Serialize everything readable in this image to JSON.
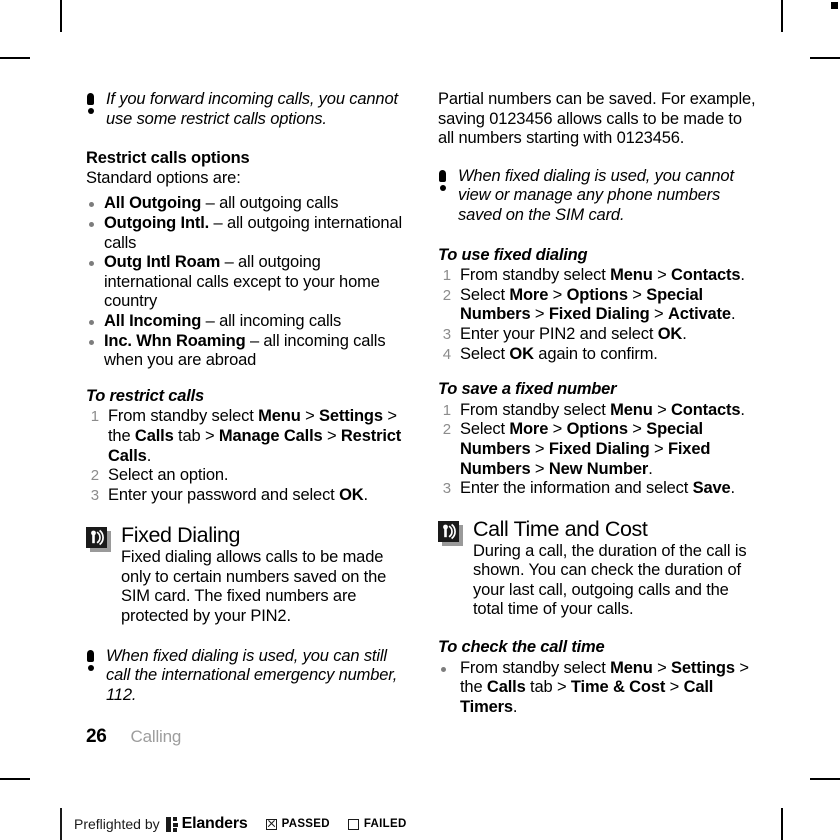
{
  "document": {
    "folio": "26",
    "chapter": "Calling"
  },
  "left_column": {
    "note_forward": {
      "icon": "exclamation-note-icon",
      "text": "If you forward incoming calls, you cannot use some restrict calls options."
    },
    "restrict_options": {
      "heading": "Restrict calls options",
      "intro": "Standard options are:",
      "items": [
        {
          "term": "All Outgoing",
          "desc": " – all outgoing calls"
        },
        {
          "term": "Outgoing Intl.",
          "desc": " – all outgoing international calls"
        },
        {
          "term": "Outg Intl Roam",
          "desc": " – all outgoing international calls except to your home country"
        },
        {
          "term": "All Incoming",
          "desc": " – all incoming calls"
        },
        {
          "term": "Inc. Whn Roaming",
          "desc": " – all incoming calls when you are abroad"
        }
      ]
    },
    "to_restrict_calls": {
      "heading": "To restrict calls",
      "steps": [
        {
          "num": "1",
          "html": "From standby select <b>Menu</b> > <b>Settings</b> > the <b>Calls</b> tab > <b>Manage Calls</b> > <b>Restrict Calls</b>."
        },
        {
          "num": "2",
          "html": "Select an option."
        },
        {
          "num": "3",
          "html": "Enter your password and select <b>OK</b>."
        }
      ]
    },
    "fixed_dialing": {
      "icon": "signal-section-icon",
      "title": "Fixed Dialing",
      "body": "Fixed dialing allows calls to be made only to certain numbers saved on the SIM card. The fixed numbers are protected by your PIN2."
    },
    "note_emergency": {
      "icon": "exclamation-note-icon",
      "text": "When fixed dialing is used, you can still call the international emergency number, 112."
    }
  },
  "right_column": {
    "partial_numbers": "Partial numbers can be saved. For example, saving 0123456 allows calls to be made to all numbers starting with 0123456.",
    "note_sim": {
      "icon": "exclamation-note-icon",
      "text": "When fixed dialing is used, you cannot view or manage any phone numbers saved on the SIM card."
    },
    "to_use_fixed_dialing": {
      "heading": "To use fixed dialing",
      "steps": [
        {
          "num": "1",
          "html": "From standby select <b>Menu</b> > <b>Contacts</b>."
        },
        {
          "num": "2",
          "html": "Select <b>More</b> > <b>Options</b> > <b>Special Numbers</b> > <b>Fixed Dialing</b> > <b>Activate</b>."
        },
        {
          "num": "3",
          "html": "Enter your PIN2 and select <b>OK</b>."
        },
        {
          "num": "4",
          "html": "Select <b>OK</b> again to confirm."
        }
      ]
    },
    "to_save_fixed_number": {
      "heading": "To save a fixed number",
      "steps": [
        {
          "num": "1",
          "html": "From standby select <b>Menu</b> > <b>Contacts</b>."
        },
        {
          "num": "2",
          "html": "Select <b>More</b> > <b>Options</b> > <b>Special Numbers</b> > <b>Fixed Dialing</b> > <b>Fixed Numbers</b> > <b>New Number</b>."
        },
        {
          "num": "3",
          "html": "Enter the information and select <b>Save</b>."
        }
      ]
    },
    "call_time_and_cost": {
      "icon": "signal-section-icon",
      "title": "Call Time and Cost",
      "body": "During a call, the duration of the call is shown. You can check the duration of your last call, outgoing calls and the total time of your calls."
    },
    "to_check_call_time": {
      "heading": "To check the call time",
      "steps": [
        {
          "num": "",
          "html": "From standby select <b>Menu</b> > <b>Settings</b> > the <b>Calls</b> tab > <b>Time &amp; Cost</b> > <b>Call Timers</b>."
        }
      ]
    }
  },
  "preflight": {
    "prefix": "Preflighted by",
    "brand": "Elanders",
    "passed_label": "PASSED",
    "failed_label": "FAILED",
    "passed_checked": true,
    "failed_checked": false
  },
  "colors": {
    "text": "#000000",
    "muted": "#9d9d9d",
    "bullet": "#7d7d7d",
    "icon_plate": "#1a1a1a",
    "icon_shadow": "#9a9a9a"
  }
}
